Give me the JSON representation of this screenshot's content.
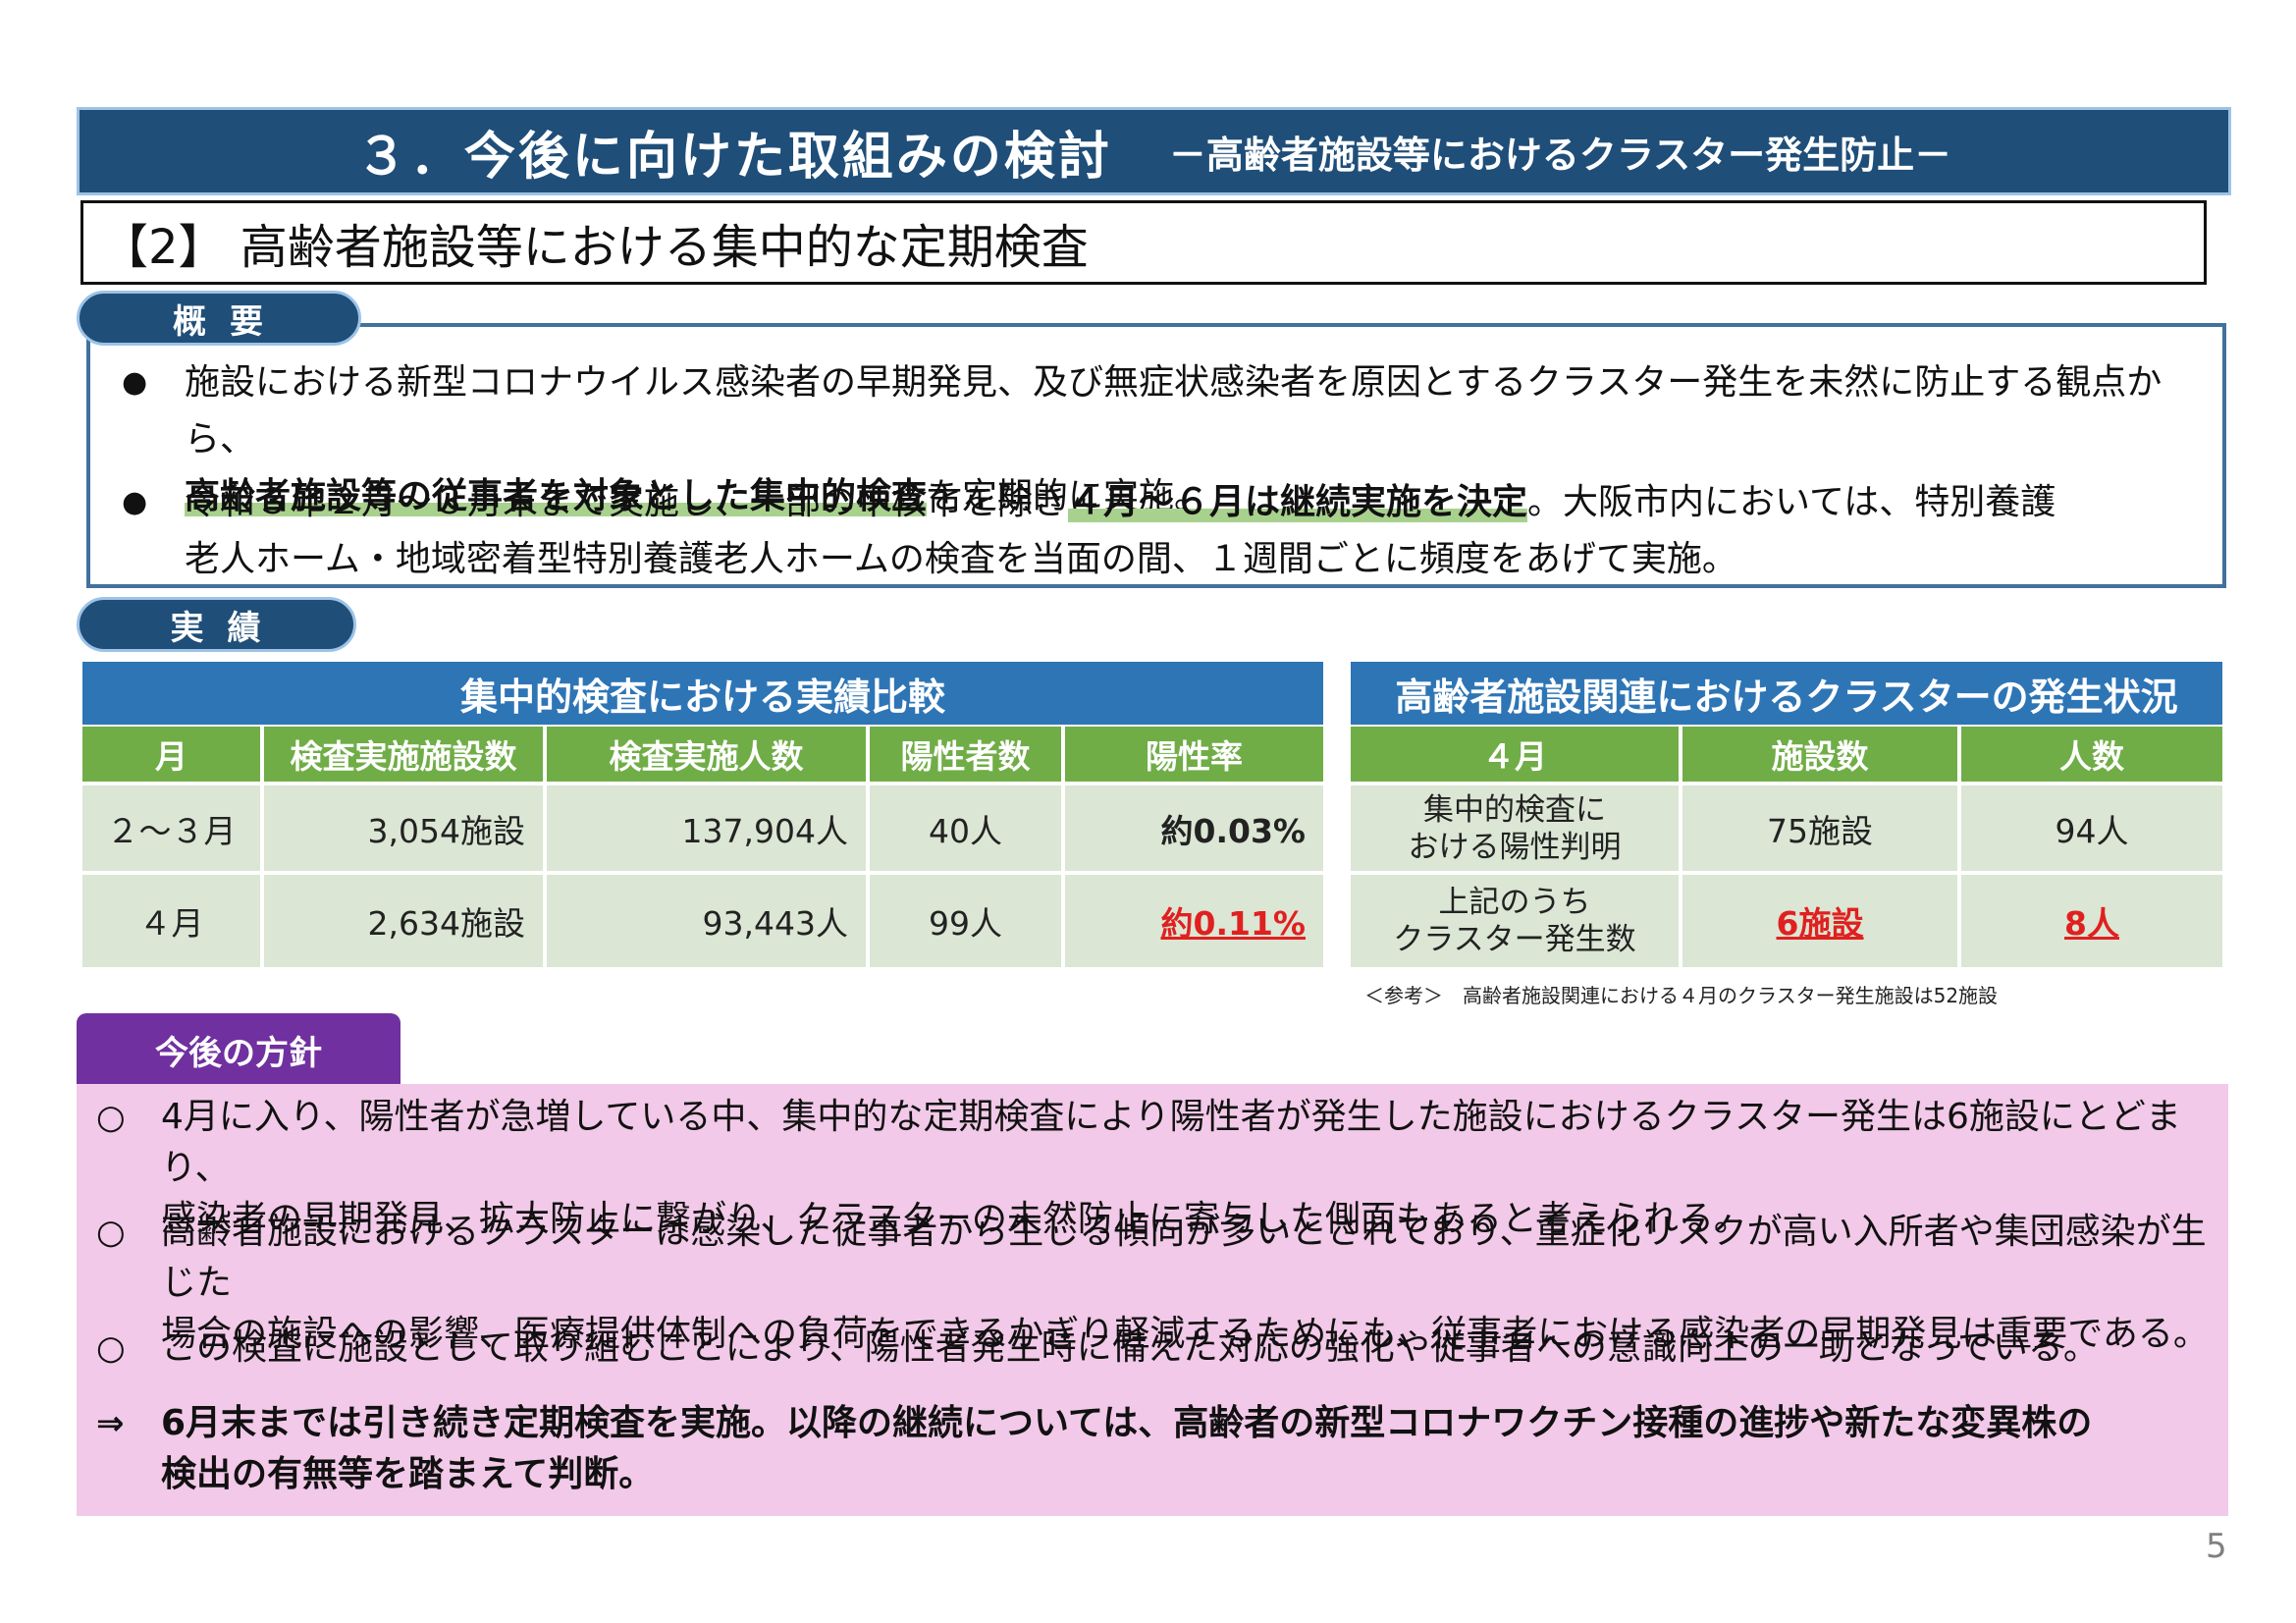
{
  "header": {
    "title": "３．今後に向けた取組みの検討",
    "subtitle": "－高齢者施設等におけるクラスター発生防止－"
  },
  "section": {
    "heading": "【2】 高齢者施設等における集中的な定期検査"
  },
  "overview": {
    "label": "概要",
    "bullet_mark": "●",
    "bullets": [
      {
        "line1": "施設における新型コロナウイルス感染者の早期発見、及び無症状感染者を原因とするクラスター発生を未然に防止する観点から、",
        "line2_highlight": "高齢者施設等の従事者を対象とした集中的検査",
        "line2_rest": "を定期的に実施。"
      },
      {
        "line1_start": "令和３年２月～３月末まで実施し、一部の中核市を除き",
        "line1_highlight": "４月～６月は継続実施を決定",
        "line1_end": "。大阪市内においては、特別養護",
        "line2": "老人ホーム・地域密着型特別養護老人ホームの検査を当面の間、１週間ごとに頻度をあげて実施。"
      }
    ]
  },
  "results": {
    "label": "実績",
    "table1": {
      "title": "集中的検査における実績比較",
      "headers": [
        "月",
        "検査実施施設数",
        "検査実施人数",
        "陽性者数",
        "陽性率"
      ],
      "rows": [
        [
          "２～３月",
          "3,054施設",
          "137,904人",
          "40人",
          "約0.03%"
        ],
        [
          "４月",
          "2,634施設",
          "93,443人",
          "99人",
          "約0.11%"
        ]
      ]
    },
    "table2": {
      "title": "高齢者施設関連におけるクラスターの発生状況",
      "headers": [
        "４月",
        "施設数",
        "人数"
      ],
      "rows": [
        {
          "label_l1": "集中的検査に",
          "label_l2": "おける陽性判明",
          "facilities": "75施設",
          "people": "94人"
        },
        {
          "label_l1": "上記のうち",
          "label_l2": "クラスター発生数",
          "facilities": "6施設",
          "people": "8人"
        }
      ],
      "note": "＜参考＞　高齢者施設関連における４月のクラスター発生施設は52施設"
    }
  },
  "policy": {
    "label": "今後の方針",
    "items": [
      {
        "mark": "○",
        "line1": "4月に入り、陽性者が急増している中、集中的な定期検査により陽性者が発生した施設におけるクラスター発生は6施設にとどまり、",
        "line2": "感染者の早期発見、拡大防止に繋がり、クラスターの未然防止に寄与した側面もあると考えられる。"
      },
      {
        "mark": "○",
        "line1": "高齢者施設におけるクラスターは感染した従事者から生じる傾向が多いとされており、重症化リスクが高い入所者や集団感染が生じた",
        "line2": "場合の施設への影響、医療提供体制への負荷をできるかぎり軽減するためにも、従事者における感染者の早期発見は重要である。"
      },
      {
        "mark": "○",
        "line1": "この検査に施設として取り組むことにより、陽性者発生時に備えた対応の強化や従事者への意識向上の一助となっている。"
      },
      {
        "mark": "⇒",
        "line1": "6月末までは引き続き定期検査を実施。以降の継続については、高齢者の新型コロナワクチン接種の進捗や新たな変異株の",
        "line2": "検出の有無等を踏まえて判断。"
      }
    ]
  },
  "page_number": "5",
  "colors": {
    "title_bar": "#1f4e79",
    "table_title": "#2e75b6",
    "table_header": "#70ad47",
    "table_cell": "#dbe6d4",
    "policy_label": "#7030a0",
    "policy_bg": "#f2c9e8",
    "emphasis_red": "#e02020"
  }
}
